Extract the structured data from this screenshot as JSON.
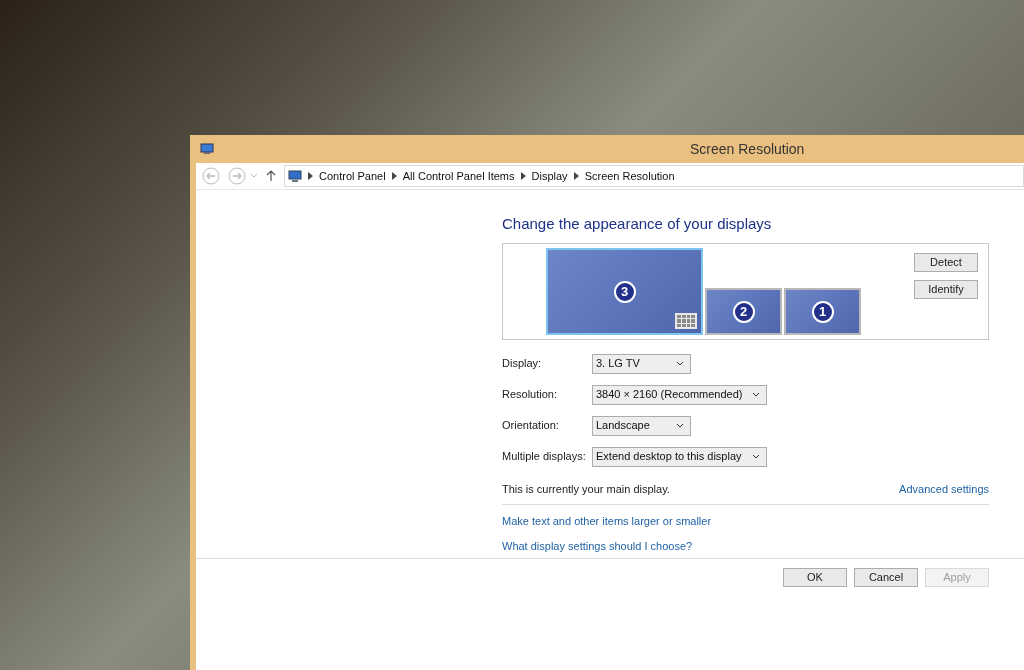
{
  "window": {
    "title": "Screen Resolution"
  },
  "breadcrumb": [
    "Control Panel",
    "All Control Panel Items",
    "Display",
    "Screen Resolution"
  ],
  "heading": "Change the appearance of your displays",
  "monitors": [
    {
      "number": "3",
      "kind": "large",
      "selected": true
    },
    {
      "number": "2",
      "kind": "small",
      "selected": false
    },
    {
      "number": "1",
      "kind": "small",
      "selected": false
    }
  ],
  "monitor_buttons": [
    "Detect",
    "Identify"
  ],
  "settings": [
    {
      "label": "Display:",
      "value": "3. LG TV"
    },
    {
      "label": "Resolution:",
      "value": "3840 × 2160 (Recommended)"
    },
    {
      "label": "Orientation:",
      "value": "Landscape"
    },
    {
      "label": "Multiple displays:",
      "value": "Extend desktop to this display"
    }
  ],
  "main_display_note": "This is currently your main display.",
  "advanced_link": "Advanced settings",
  "links": [
    "Make text and other items larger or smaller",
    "What display settings should I choose?"
  ],
  "buttons": [
    {
      "label": "OK",
      "disabled": false
    },
    {
      "label": "Cancel",
      "disabled": false
    },
    {
      "label": "Apply",
      "disabled": true
    }
  ]
}
